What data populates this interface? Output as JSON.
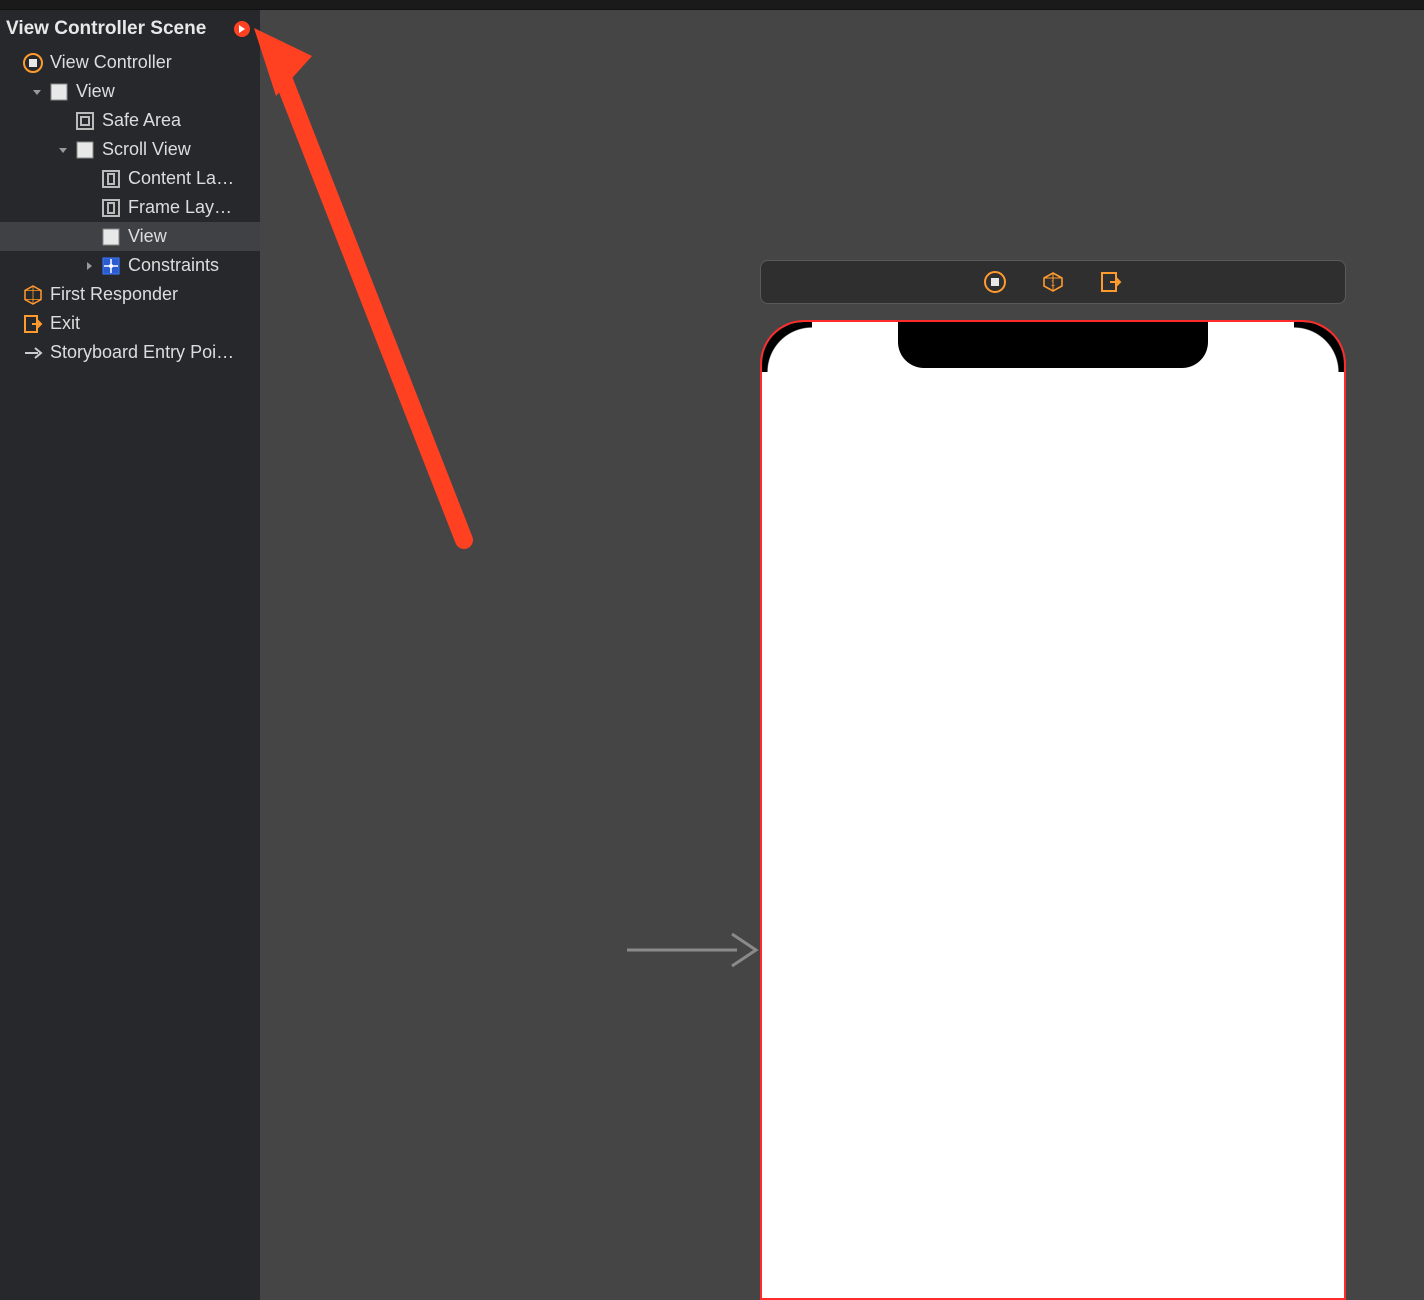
{
  "scene": {
    "title": "View Controller Scene",
    "status_icon": "entry-point-indicator"
  },
  "tree": [
    {
      "indent": 0,
      "disclosure": "none",
      "icon": "view-controller-icon",
      "label": "View Controller",
      "selected": false
    },
    {
      "indent": 1,
      "disclosure": "down",
      "icon": "view-icon",
      "label": "View",
      "selected": false
    },
    {
      "indent": 2,
      "disclosure": "none",
      "icon": "safe-area-icon",
      "label": "Safe Area",
      "selected": false
    },
    {
      "indent": 2,
      "disclosure": "down",
      "icon": "view-icon",
      "label": "Scroll View",
      "selected": false
    },
    {
      "indent": 3,
      "disclosure": "none",
      "icon": "layout-guide-icon",
      "label": "Content La…",
      "selected": false
    },
    {
      "indent": 3,
      "disclosure": "none",
      "icon": "layout-guide-icon",
      "label": "Frame Lay…",
      "selected": false
    },
    {
      "indent": 3,
      "disclosure": "none",
      "icon": "view-icon",
      "label": "View",
      "selected": true
    },
    {
      "indent": 3,
      "disclosure": "right",
      "icon": "constraints-icon",
      "label": "Constraints",
      "selected": false
    },
    {
      "indent": 0,
      "disclosure": "none",
      "icon": "first-responder-icon",
      "label": "First Responder",
      "selected": false
    },
    {
      "indent": 0,
      "disclosure": "none",
      "icon": "exit-icon",
      "label": "Exit",
      "selected": false
    },
    {
      "indent": 0,
      "disclosure": "none",
      "icon": "arrow-right-icon",
      "label": "Storyboard Entry Poi…",
      "selected": false
    }
  ],
  "dock": {
    "items": [
      {
        "name": "view-controller-icon"
      },
      {
        "name": "first-responder-icon"
      },
      {
        "name": "exit-icon"
      }
    ]
  },
  "colors": {
    "accent": "#ff9022",
    "annotation_arrow": "#ff4122",
    "selection_outline": "#ff2a2a"
  }
}
